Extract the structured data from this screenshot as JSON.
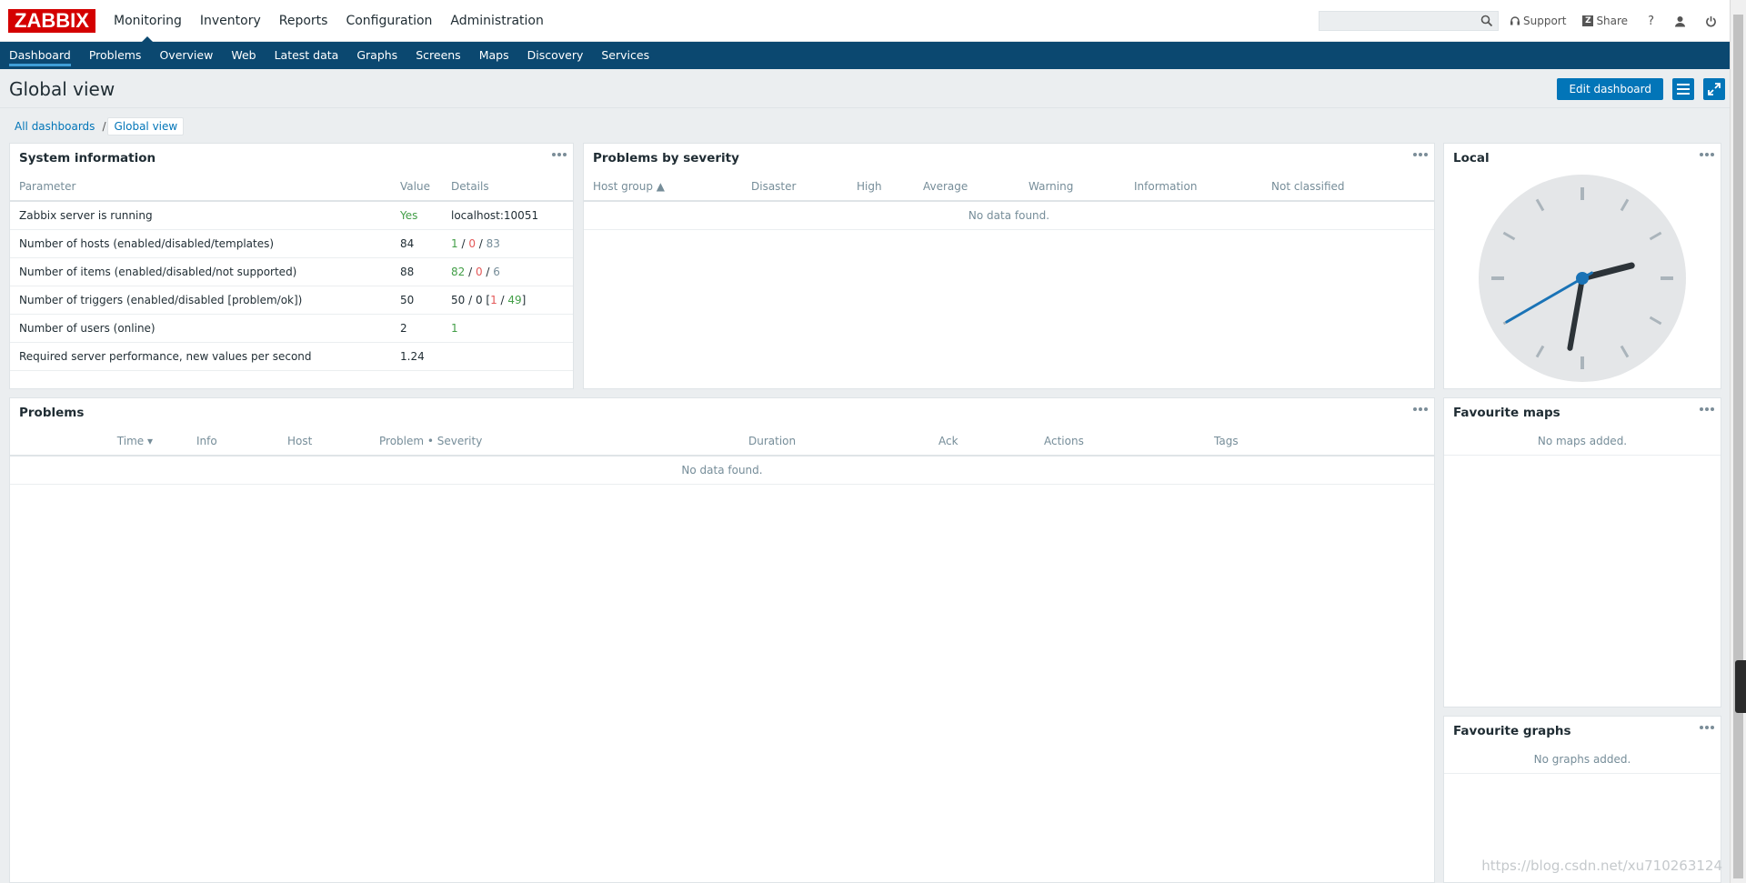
{
  "brand": {
    "logo_text": "ZABBIX"
  },
  "main_menu": [
    {
      "label": "Monitoring",
      "active": true
    },
    {
      "label": "Inventory"
    },
    {
      "label": "Reports"
    },
    {
      "label": "Configuration"
    },
    {
      "label": "Administration"
    }
  ],
  "header": {
    "search_value": "",
    "support": "Support",
    "share": "Share",
    "share_badge": "Z",
    "help": "?"
  },
  "sub_menu": [
    {
      "label": "Dashboard",
      "active": true
    },
    {
      "label": "Problems"
    },
    {
      "label": "Overview"
    },
    {
      "label": "Web"
    },
    {
      "label": "Latest data"
    },
    {
      "label": "Graphs"
    },
    {
      "label": "Screens"
    },
    {
      "label": "Maps"
    },
    {
      "label": "Discovery"
    },
    {
      "label": "Services"
    }
  ],
  "page": {
    "title": "Global view",
    "edit_button": "Edit dashboard"
  },
  "breadcrumbs": {
    "all": "All dashboards",
    "separator": "/",
    "current": "Global view"
  },
  "system_info": {
    "title": "System information",
    "columns": [
      "Parameter",
      "Value",
      "Details"
    ],
    "rows": [
      {
        "param": "Zabbix server is running",
        "value": "Yes",
        "d": [
          "localhost:10051"
        ]
      },
      {
        "param": "Number of hosts (enabled/disabled/templates)",
        "value": "84",
        "d": [
          "1",
          " / ",
          "0",
          " / ",
          "83"
        ]
      },
      {
        "param": "Number of items (enabled/disabled/not supported)",
        "value": "88",
        "d": [
          "82",
          " / ",
          "0",
          " / ",
          "6"
        ]
      },
      {
        "param": "Number of triggers (enabled/disabled [problem/ok])",
        "value": "50",
        "d": [
          "50 / 0 [",
          "1",
          " / ",
          "49",
          "]"
        ]
      },
      {
        "param": "Number of users (online)",
        "value": "2",
        "d": [
          "1"
        ]
      },
      {
        "param": "Required server performance, new values per second",
        "value": "1.24",
        "d": [
          ""
        ]
      }
    ]
  },
  "problems_by_severity": {
    "title": "Problems by severity",
    "columns": [
      "Host group ▲",
      "Disaster",
      "High",
      "Average",
      "Warning",
      "Information",
      "Not classified"
    ],
    "empty": "No data found."
  },
  "clock": {
    "title": "Local",
    "hour": 2,
    "minute": 31,
    "second": 40
  },
  "problems": {
    "title": "Problems",
    "columns": [
      "Time ▾",
      "Info",
      "Host",
      "Problem • Severity",
      "Duration",
      "Ack",
      "Actions",
      "Tags"
    ],
    "empty": "No data found."
  },
  "fav_maps": {
    "title": "Favourite maps",
    "empty": "No maps added."
  },
  "fav_graphs": {
    "title": "Favourite graphs",
    "empty": "No graphs added."
  },
  "watermark": "https://blog.csdn.net/xu710263124",
  "colors": {
    "nav_bg": "#0b4870",
    "accent": "#0275b8",
    "logo_red": "#d40000",
    "ok_green": "#429e47",
    "problem_red": "#e45959"
  }
}
